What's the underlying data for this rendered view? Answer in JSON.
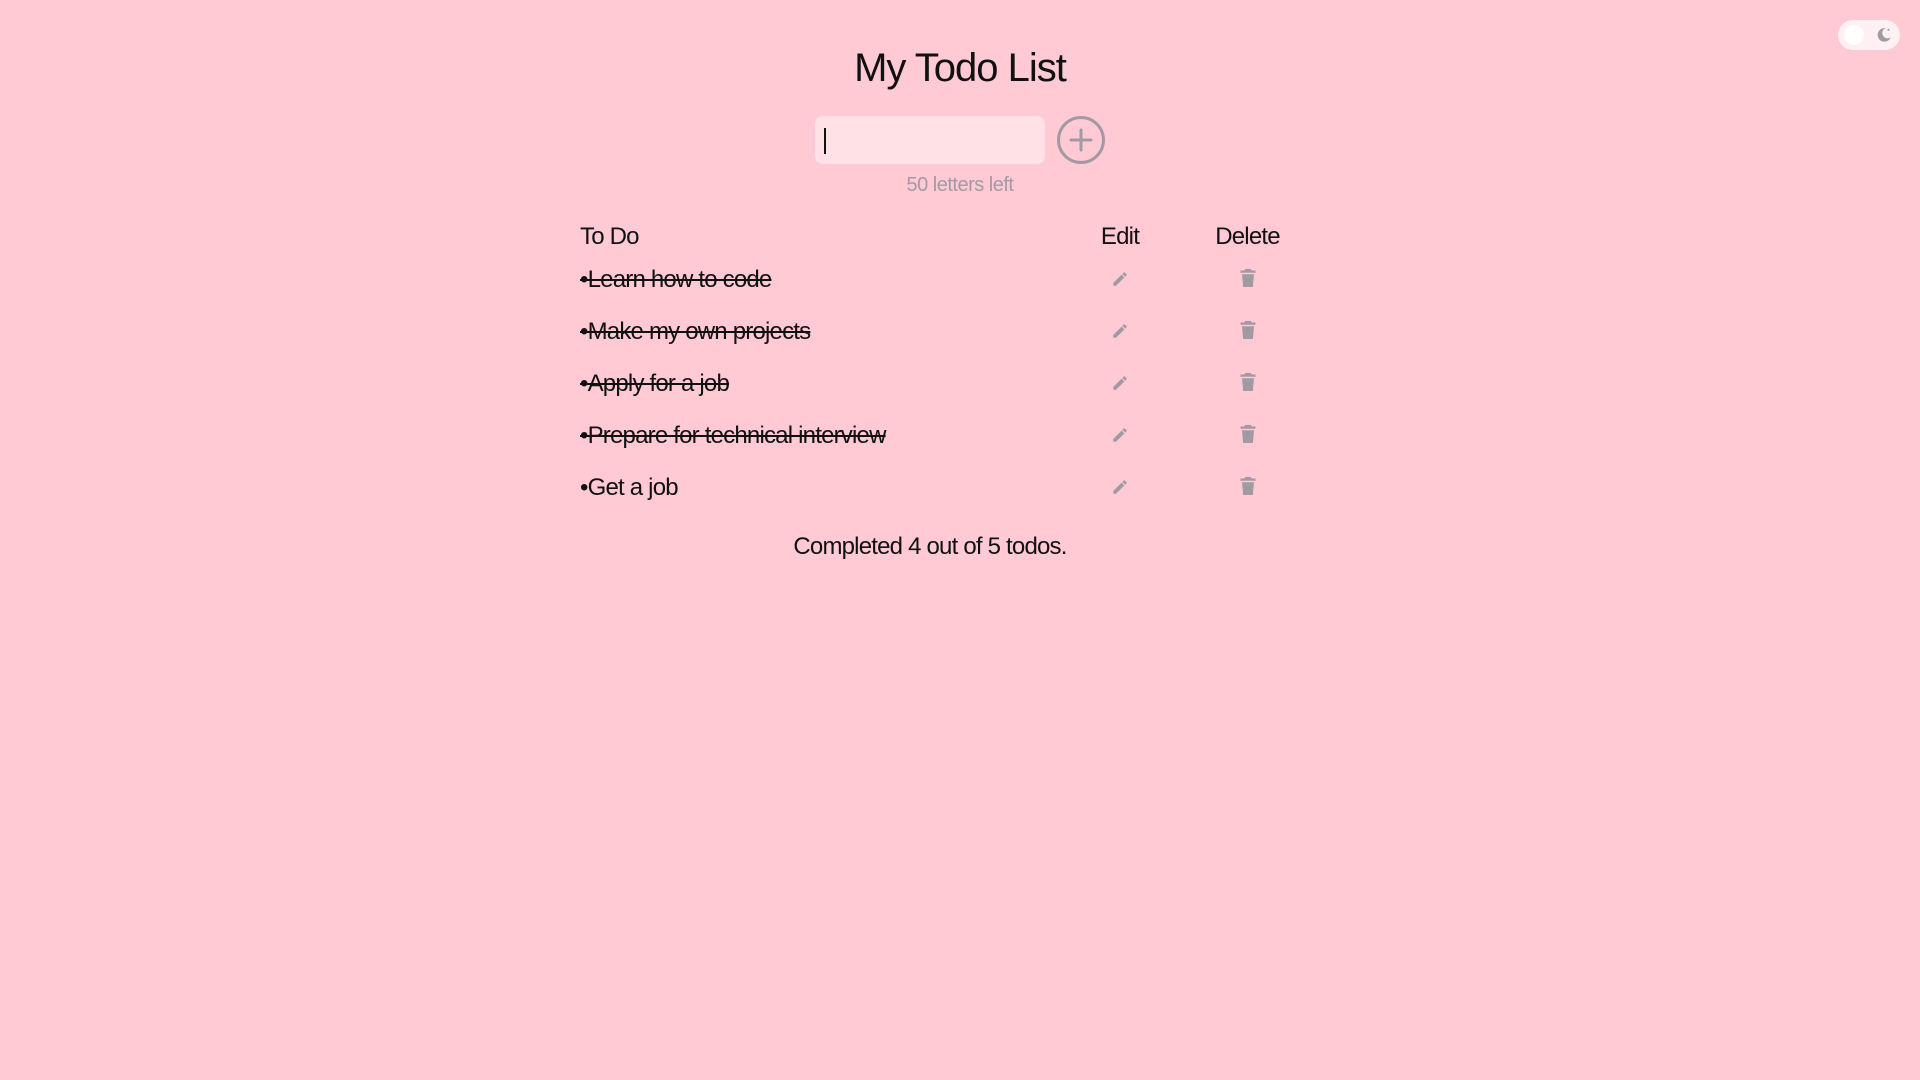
{
  "app": {
    "title": "My Todo List"
  },
  "theme_toggle": {
    "icon": "moon-icon",
    "state": "light"
  },
  "input": {
    "value": "",
    "letters_left_text": "50 letters left"
  },
  "table": {
    "headers": {
      "todo": "To Do",
      "edit": "Edit",
      "delete": "Delete"
    },
    "rows": [
      {
        "text": "•Learn how to code",
        "done": true
      },
      {
        "text": "•Make my own projects",
        "done": true
      },
      {
        "text": "•Apply for a job",
        "done": true
      },
      {
        "text": "•Prepare for technical interview",
        "done": true
      },
      {
        "text": "•Get a job",
        "done": false
      }
    ]
  },
  "summary": "Completed 4 out of 5 todos.",
  "colors": {
    "background": "#ffcad4",
    "input_bg": "#ffe1e6",
    "icon_gray": "#a29aa3",
    "text": "#111111"
  }
}
